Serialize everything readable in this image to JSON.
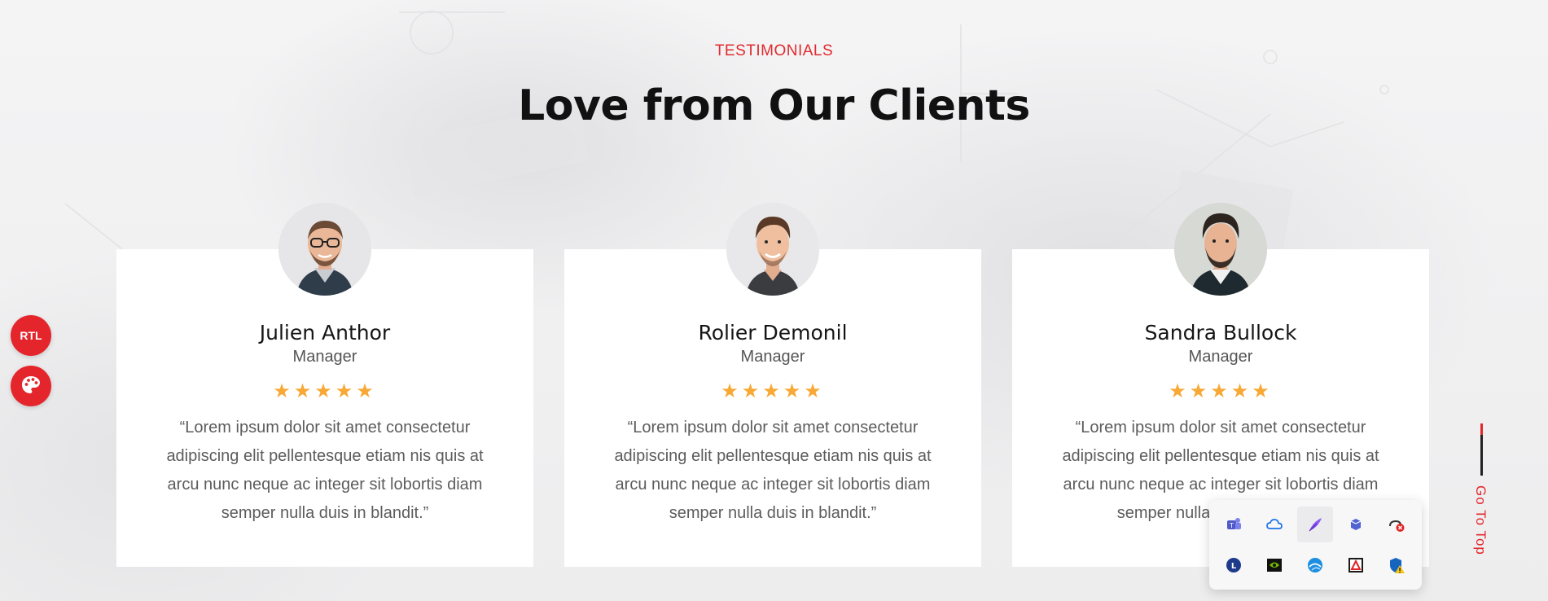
{
  "section": {
    "tag": "TESTIMONIALS",
    "title": "Love from Our Clients"
  },
  "testimonials": [
    {
      "name": "Julien Anthor",
      "role": "Manager",
      "stars": "★★★★★",
      "rating": 5,
      "quote": "“Lorem ipsum dolor sit amet consectetur adipiscing elit pellentesque etiam nis quis at arcu nunc neque ac integer sit lobortis diam semper nulla duis in blandit.”"
    },
    {
      "name": "Rolier Demonil",
      "role": "Manager",
      "stars": "★★★★★",
      "rating": 5,
      "quote": "“Lorem ipsum dolor sit amet consectetur adipiscing elit pellentesque etiam nis quis at arcu nunc neque ac integer sit lobortis diam semper nulla duis in blandit.”"
    },
    {
      "name": "Sandra Bullock",
      "role": "Manager",
      "stars": "★★★★★",
      "rating": 5,
      "quote": "“Lorem ipsum dolor sit amet consectetur adipiscing elit pellentesque etiam nis quis at arcu nunc neque ac integer sit lobortis diam semper nulla duis in blandit.”"
    }
  ],
  "side_buttons": {
    "rtl_label": "RTL",
    "palette_icon": "palette-icon"
  },
  "go_to_top": {
    "label": "Go To Top"
  },
  "tray_icons": [
    "teams-icon",
    "cloud-icon",
    "feather-icon",
    "box-icon",
    "network-error-icon",
    "l-circle-icon",
    "nvidia-icon",
    "globe-icon",
    "pdf-icon",
    "shield-warning-icon"
  ],
  "colors": {
    "accent": "#e4262c",
    "star": "#f8a834",
    "title": "#111111"
  }
}
